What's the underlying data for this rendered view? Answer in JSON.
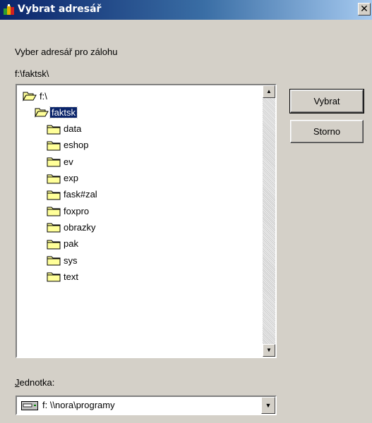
{
  "window": {
    "title": "Vybrat adresář",
    "close_glyph": "✕"
  },
  "prompt": "Vyber adresář pro zálohu",
  "current_path": "f:\\faktsk\\",
  "tree": {
    "items": [
      {
        "label": "f:\\",
        "icon": "open-folder-icon",
        "level": 0,
        "selected": false
      },
      {
        "label": "faktsk",
        "icon": "open-folder-icon",
        "level": 1,
        "selected": true
      },
      {
        "label": "data",
        "icon": "folder-icon",
        "level": 2,
        "selected": false
      },
      {
        "label": "eshop",
        "icon": "folder-icon",
        "level": 2,
        "selected": false
      },
      {
        "label": "ev",
        "icon": "folder-icon",
        "level": 2,
        "selected": false
      },
      {
        "label": "exp",
        "icon": "folder-icon",
        "level": 2,
        "selected": false
      },
      {
        "label": "fask#zal",
        "icon": "folder-icon",
        "level": 2,
        "selected": false
      },
      {
        "label": "foxpro",
        "icon": "folder-icon",
        "level": 2,
        "selected": false
      },
      {
        "label": "obrazky",
        "icon": "folder-icon",
        "level": 2,
        "selected": false
      },
      {
        "label": "pak",
        "icon": "folder-icon",
        "level": 2,
        "selected": false
      },
      {
        "label": "sys",
        "icon": "folder-icon",
        "level": 2,
        "selected": false
      },
      {
        "label": "text",
        "icon": "folder-icon",
        "level": 2,
        "selected": false
      }
    ],
    "scroll_up_glyph": "▲",
    "scroll_down_glyph": "▼"
  },
  "buttons": {
    "select": "Vybrat",
    "cancel": "Storno"
  },
  "drive": {
    "label_accel": "J",
    "label_rest": "ednotka:",
    "value": "f: \\\\nora\\programy",
    "icon": "network-drive-icon",
    "arrow_glyph": "▼"
  },
  "colors": {
    "title_start": "#0a246a",
    "title_end": "#a6caf0",
    "face": "#d4d0c8",
    "selection": "#0a246a",
    "folder": "#ffff99"
  }
}
